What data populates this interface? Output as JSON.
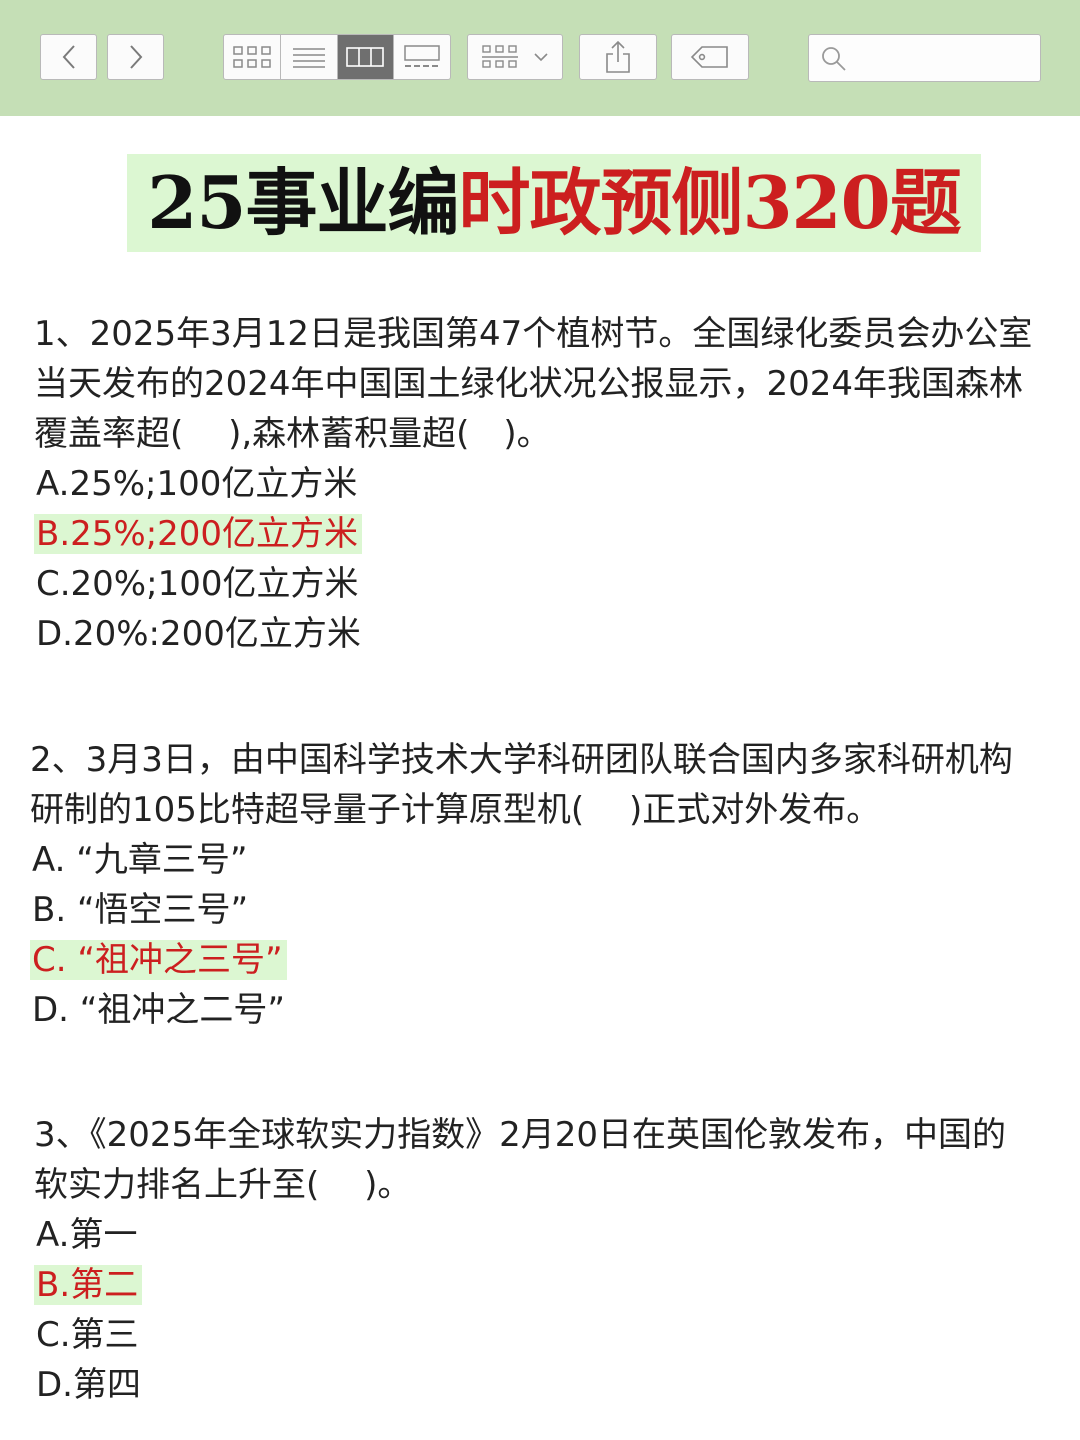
{
  "toolbar": {
    "back_icon": "chevron-left-icon",
    "forward_icon": "chevron-right-icon",
    "view_modes": [
      "grid-view-icon",
      "list-view-icon",
      "column-view-icon",
      "gallery-view-icon"
    ],
    "active_view": "column-view-icon",
    "group_icon": "group-by-icon",
    "share_icon": "share-icon",
    "tag_icon": "tag-icon",
    "search": {
      "value": "",
      "placeholder": ""
    }
  },
  "colors": {
    "toolbar_bg": "#c5dfb6",
    "highlight_bg": "#dcf7d2",
    "answer_red": "#cc1f1f"
  },
  "document": {
    "title_black": "25事业编",
    "title_red": "时政预侧320题",
    "questions": [
      {
        "text": "1、2025年3月12日是我国第47个植树节。全国绿化委员会办公室当天发布的2024年中国国土绿化状况公报显示，2024年我国森林覆盖率超(　 ),森林蓄积量超(　)。",
        "options": [
          {
            "label": "A.25%;100亿立方米",
            "correct": false
          },
          {
            "label": "B.25%;200亿立方米",
            "correct": true
          },
          {
            "label": "C.20%;100亿立方米",
            "correct": false
          },
          {
            "label": "D.20%:200亿立方米",
            "correct": false
          }
        ]
      },
      {
        "text": "2、3月3日，由中国科学技术大学科研团队联合国内多家科研机构研制的105比特超导量子计算原型机(　 )正式对外发布。",
        "options": [
          {
            "label": "A. “九章三号”",
            "correct": false
          },
          {
            "label": "B. “悟空三号”",
            "correct": false
          },
          {
            "label": "C. “祖冲之三号”",
            "correct": true
          },
          {
            "label": "D. “祖冲之二号”",
            "correct": false
          }
        ]
      },
      {
        "text": "3、《2025年全球软实力指数》2月20日在英国伦敦发布，中国的软实力排名上升至(　 )。",
        "options": [
          {
            "label": "A.第一",
            "correct": false
          },
          {
            "label": "B.第二",
            "correct": true
          },
          {
            "label": "C.第三",
            "correct": false
          },
          {
            "label": "D.第四",
            "correct": false
          }
        ]
      }
    ]
  }
}
